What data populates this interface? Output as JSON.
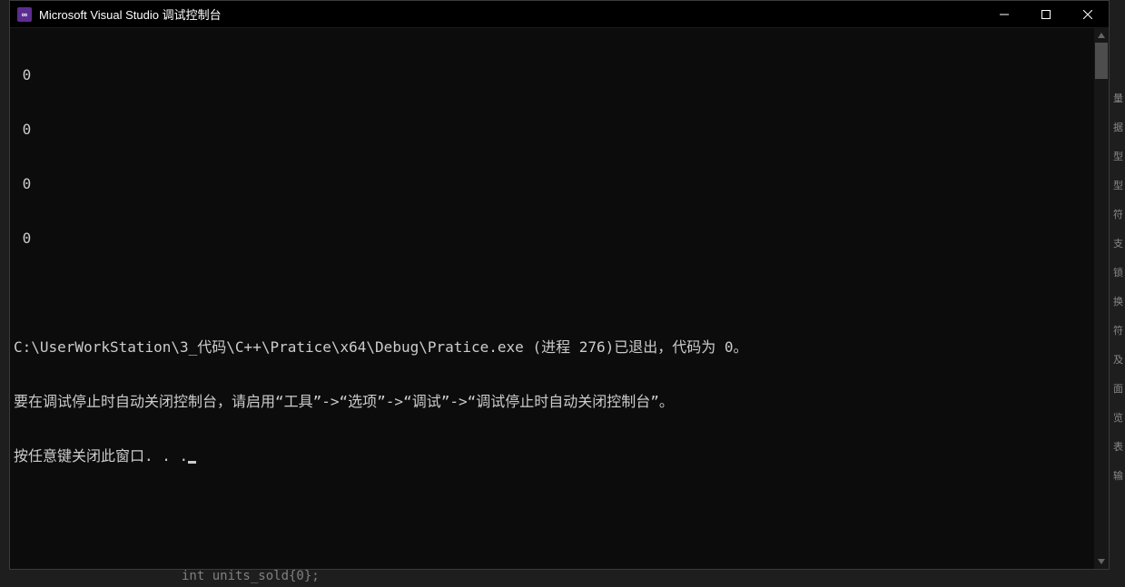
{
  "window": {
    "title": "Microsoft Visual Studio 调试控制台",
    "icon_label": "∞"
  },
  "console": {
    "lines": [
      " 0",
      " 0",
      " 0",
      " 0",
      "",
      "C:\\UserWorkStation\\3_代码\\C++\\Pratice\\x64\\Debug\\Pratice.exe (进程 276)已退出，代码为 0。",
      "要在调试停止时自动关闭控制台，请启用“工具”->“选项”->“调试”->“调试停止时自动关闭控制台”。",
      "按任意键关闭此窗口. . ."
    ]
  },
  "background_editor": {
    "bottom_code": "int units_sold{0};",
    "right_hints": [
      "量",
      "据",
      "型",
      "型",
      "符",
      "支",
      "锁",
      "换",
      "符",
      "及",
      "面",
      "览",
      "表",
      "输"
    ]
  }
}
